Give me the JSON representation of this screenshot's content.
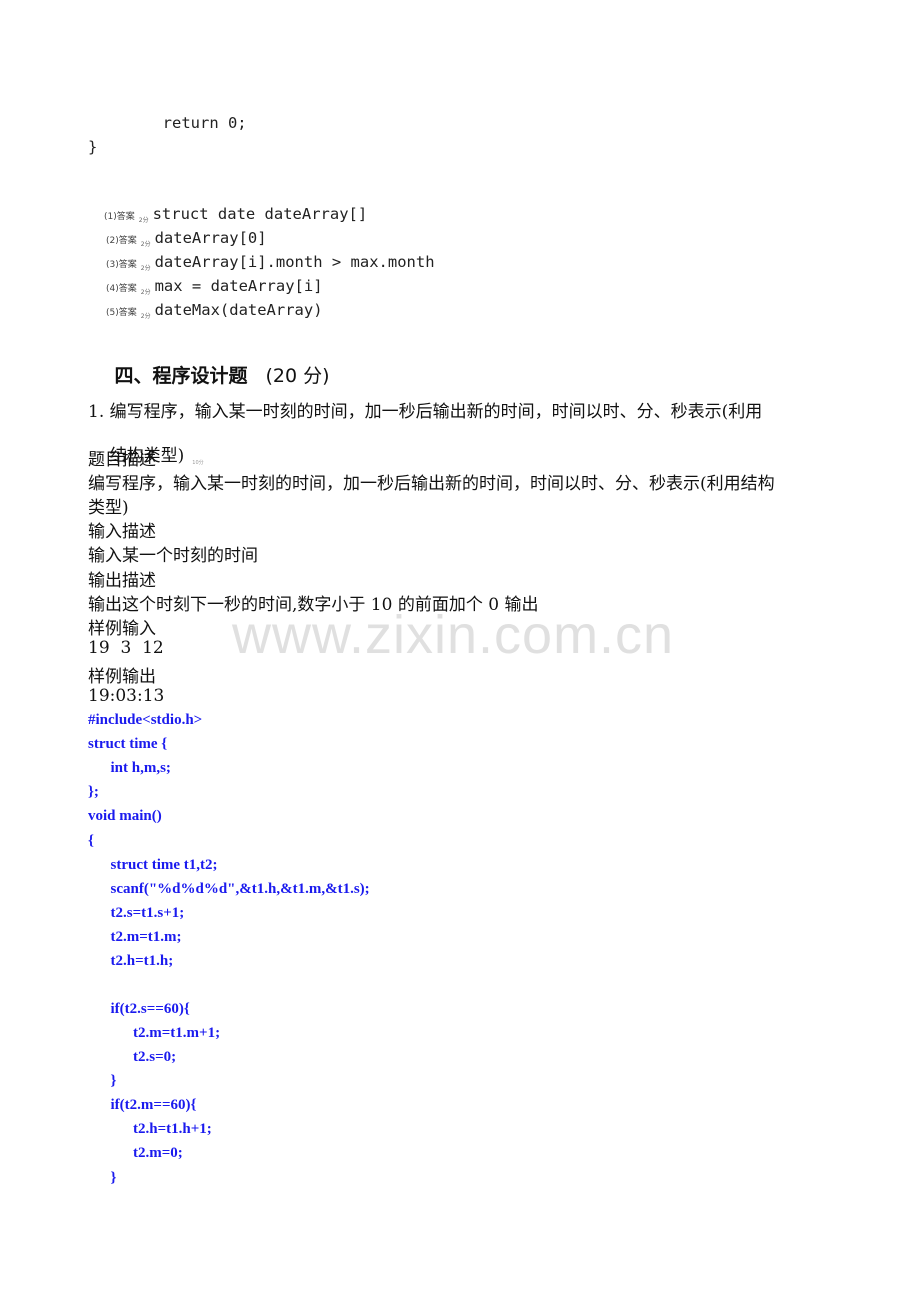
{
  "code_tail": {
    "lines": [
      "        return 0;",
      "}"
    ]
  },
  "answers": [
    {
      "tag": "(1)答案",
      "points": "2分",
      "text": "struct date dateArray[]"
    },
    {
      "tag": "(2)答案",
      "points": "2分",
      "text": "dateArray[0]"
    },
    {
      "tag": "(3)答案",
      "points": "2分",
      "text": "dateArray[i].month > max.month"
    },
    {
      "tag": "(4)答案",
      "points": "2分",
      "text": "max = dateArray[i]"
    },
    {
      "tag": "(5)答案",
      "points": "2分",
      "text": "dateMax(dateArray)"
    }
  ],
  "section": {
    "title": "四、程序设计题",
    "points": "(20 分)"
  },
  "question": {
    "line1": "1. 编写程序，输入某一时刻的时间，加一秒后输出新的时间，时间以时、分、秒表示(利用",
    "line2": "结构类型)",
    "points_mark": "10分",
    "desc_label": "题目描述",
    "desc_line1": "编写程序，输入某一时刻的时间，加一秒后输出新的时间，时间以时、分、秒表示(利用结构",
    "desc_line2": "类型)",
    "input_label": "输入描述",
    "input_text": "输入某一个时刻的时间",
    "output_label": "输出描述",
    "output_text": "输出这个时刻下一秒的时间,数字小于 10 的前面加个 0 输出",
    "sample_in_label": "样例输入",
    "sample_in": "19  3  12",
    "sample_out_label": "样例输出",
    "sample_out": "19:03:13"
  },
  "solution_code": [
    "#include<stdio.h>",
    "struct time {",
    "      int h,m,s;",
    "};",
    "void main()",
    "{",
    "      struct time t1,t2;",
    "      scanf(\"%d%d%d\",&t1.h,&t1.m,&t1.s);",
    "      t2.s=t1.s+1;",
    "      t2.m=t1.m;",
    "      t2.h=t1.h;",
    "",
    "      if(t2.s==60){",
    "            t2.m=t1.m+1;",
    "            t2.s=0;",
    "      }",
    "      if(t2.m==60){",
    "            t2.h=t1.h+1;",
    "            t2.m=0;",
    "      }"
  ],
  "watermark": "www.zixin.com.cn",
  "colors": {
    "code_blue": "#1a1aee",
    "watermark_gray": "#e0e0e0"
  }
}
